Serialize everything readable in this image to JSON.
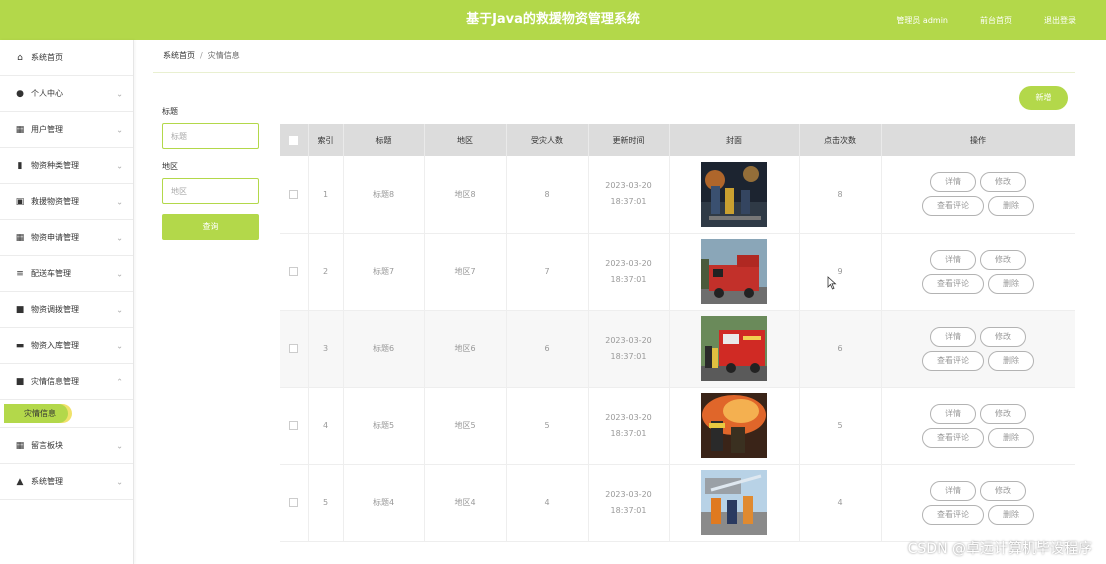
{
  "header": {
    "title": "基于Java的救援物资管理系统",
    "user": "管理员 admin",
    "profile_link": "前台首页",
    "logout_link": "退出登录"
  },
  "sidebar": {
    "items": [
      {
        "icon": "home-icon",
        "glyph": "⌂",
        "label": "系统首页",
        "arrow": ""
      },
      {
        "icon": "person-icon",
        "glyph": "●",
        "label": "个人中心",
        "arrow": "⌄"
      },
      {
        "icon": "grid-icon",
        "glyph": "▦",
        "label": "用户管理",
        "arrow": "⌄"
      },
      {
        "icon": "bar-chart-icon",
        "glyph": "▮",
        "label": "物资种类管理",
        "arrow": "⌄"
      },
      {
        "icon": "box-icon",
        "glyph": "▣",
        "label": "救援物资管理",
        "arrow": "⌄"
      },
      {
        "icon": "grid-icon",
        "glyph": "▦",
        "label": "物资申请管理",
        "arrow": "⌄"
      },
      {
        "icon": "list-icon",
        "glyph": "≡",
        "label": "配送车管理",
        "arrow": "⌄"
      },
      {
        "icon": "book-icon",
        "glyph": "■",
        "label": "物资调拨管理",
        "arrow": "⌄"
      },
      {
        "icon": "stack-icon",
        "glyph": "▬",
        "label": "物资入库管理",
        "arrow": "⌄"
      },
      {
        "icon": "book-icon",
        "glyph": "■",
        "label": "灾情信息管理",
        "arrow": "⌃"
      }
    ],
    "active_sub": "灾情信息",
    "items_after": [
      {
        "icon": "grid-icon",
        "glyph": "▦",
        "label": "留言板块",
        "arrow": "⌄"
      },
      {
        "icon": "chart-icon",
        "glyph": "▲",
        "label": "系统管理",
        "arrow": "⌄"
      }
    ]
  },
  "breadcrumb": {
    "home": "系统首页",
    "separator": "/",
    "current": "灾情信息"
  },
  "filters": {
    "field1_label": "标题",
    "field1_placeholder": "标题",
    "field2_label": "地区",
    "field2_placeholder": "地区",
    "search_label": "查询"
  },
  "add_label": "新增",
  "table": {
    "columns": [
      "索引",
      "标题",
      "地区",
      "受灾人数",
      "更新时间",
      "封面",
      "点击次数",
      "操作"
    ],
    "rows": [
      {
        "index": "1",
        "title": "标题8",
        "region": "地区8",
        "count": "8",
        "time": "2023-03-20 18:37:01",
        "clicks": "8",
        "img": "fire-night"
      },
      {
        "index": "2",
        "title": "标题7",
        "region": "地区7",
        "count": "7",
        "time": "2023-03-20 18:37:01",
        "clicks": "9",
        "img": "truck-street"
      },
      {
        "index": "3",
        "title": "标题6",
        "region": "地区6",
        "count": "6",
        "time": "2023-03-20 18:37:01",
        "clicks": "6",
        "img": "truck-crew"
      },
      {
        "index": "4",
        "title": "标题5",
        "region": "地区5",
        "count": "5",
        "time": "2023-03-20 18:37:01",
        "clicks": "5",
        "img": "flames"
      },
      {
        "index": "5",
        "title": "标题4",
        "region": "地区4",
        "count": "4",
        "time": "2023-03-20 18:37:01",
        "clicks": "4",
        "img": "hose-team"
      }
    ],
    "actions": {
      "detail": "详情",
      "edit": "修改",
      "reviews": "查看评论",
      "delete": "删除"
    }
  },
  "watermark": "CSDN @卓远计算机毕设程序",
  "colors": {
    "accent": "#b3d84a",
    "table_header": "#dcdcdc"
  }
}
